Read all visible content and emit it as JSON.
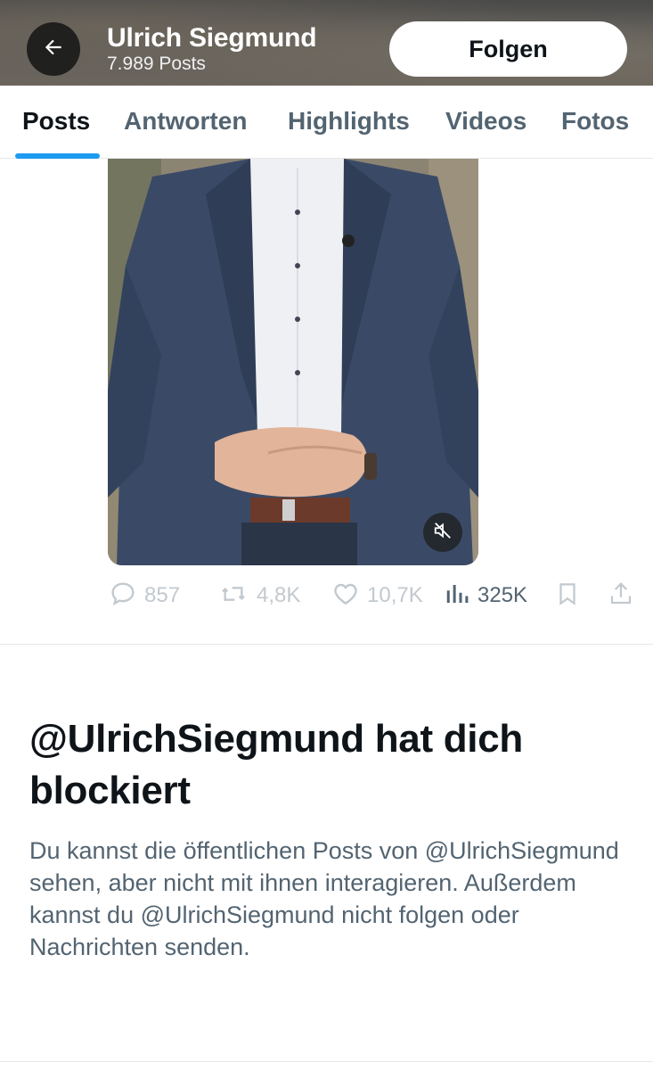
{
  "header": {
    "title": "Ulrich Siegmund",
    "post_count": "7.989 Posts",
    "back_icon": "arrow-left-icon",
    "follow_label": "Folgen"
  },
  "tabs": [
    {
      "label": "Posts",
      "active": true
    },
    {
      "label": "Antworten",
      "active": false
    },
    {
      "label": "Highlights",
      "active": false
    },
    {
      "label": "Videos",
      "active": false
    },
    {
      "label": "Fotos",
      "active": false
    }
  ],
  "post": {
    "media_icon": "mute-icon",
    "replies": "857",
    "reposts": "4,8K",
    "likes": "10,7K",
    "views": "325K"
  },
  "notice": {
    "title": "@UlrichSiegmund hat dich blockiert",
    "body": "Du kannst die öffentlichen Posts von @UlrichSiegmund sehen, aber nicht mit ihnen interagieren. Außerdem kannst du @UlrichSiegmund nicht folgen oder Nachrichten senden."
  },
  "colors": {
    "accent": "#1d9bf0",
    "text_primary": "#0f1419",
    "text_secondary": "#536471",
    "disabled": "#c2c9cf"
  }
}
